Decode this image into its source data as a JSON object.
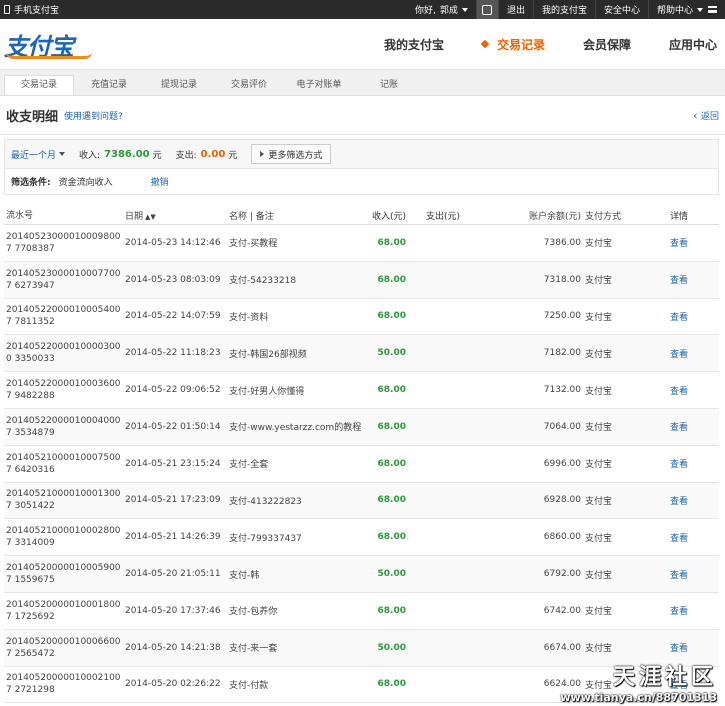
{
  "topbar": {
    "mobile_link": "手机支付宝",
    "greeting": "你好,",
    "username": "郭成",
    "logout": "退出",
    "my_alipay": "我的支付宝",
    "security": "安全中心",
    "help": "帮助中心"
  },
  "header": {
    "logo_text": "支付宝",
    "nav": [
      {
        "label": "我的支付宝",
        "active": false
      },
      {
        "label": "交易记录",
        "active": true
      },
      {
        "label": "会员保障",
        "active": false
      },
      {
        "label": "应用中心",
        "active": false
      }
    ]
  },
  "subnav": [
    "交易记录",
    "充值记录",
    "提现记录",
    "交易评价",
    "电子对账单",
    "记账"
  ],
  "page": {
    "title": "收支明细",
    "help_link": "使用遇到问题?",
    "back_link": "返回"
  },
  "filter": {
    "period": "最近一个月",
    "income_label": "收入:",
    "income_value": "7386.00",
    "expense_label": "支出:",
    "expense_value": "0.00",
    "unit": "元",
    "more_button": "更多筛选方式",
    "condition_label": "筛选条件:",
    "condition_value": "资金流向收入",
    "cancel": "撤销"
  },
  "table": {
    "headers": {
      "serial": "流水号",
      "date": "日期",
      "name": "名称 | 备注",
      "income": "收入(元)",
      "expense": "支出(元)",
      "balance": "账户余额(元)",
      "method": "支付方式",
      "detail": "详情"
    },
    "rows": [
      {
        "serial": "201405230000100098007 7708387",
        "date": "2014-05-23 14:12:46",
        "name": "支付-买教程",
        "income": "68.00",
        "balance": "7386.00",
        "method": "支付宝",
        "detail": "查看"
      },
      {
        "serial": "201405230000100077007 6273947",
        "date": "2014-05-23 08:03:09",
        "name": "支付-54233218",
        "income": "68.00",
        "balance": "7318.00",
        "method": "支付宝",
        "detail": "查看"
      },
      {
        "serial": "201405220000100054007 7811352",
        "date": "2014-05-22 14:07:59",
        "name": "支付-资料",
        "income": "68.00",
        "balance": "7250.00",
        "method": "支付宝",
        "detail": "查看"
      },
      {
        "serial": "201405220000100003000 3350033",
        "date": "2014-05-22 11:18:23",
        "name": "支付-韩国26部视频",
        "income": "50.00",
        "balance": "7182.00",
        "method": "支付宝",
        "detail": "查看"
      },
      {
        "serial": "201405220000100036007 9482288",
        "date": "2014-05-22 09:06:52",
        "name": "支付-好男人你懂得",
        "income": "68.00",
        "balance": "7132.00",
        "method": "支付宝",
        "detail": "查看"
      },
      {
        "serial": "201405220000100040007 3534879",
        "date": "2014-05-22 01:50:14",
        "name": "支付-www.yestarzz.com的教程",
        "income": "68.00",
        "balance": "7064.00",
        "method": "支付宝",
        "detail": "查看"
      },
      {
        "serial": "201405210000100075007 6420316",
        "date": "2014-05-21 23:15:24",
        "name": "支付-全套",
        "income": "68.00",
        "balance": "6996.00",
        "method": "支付宝",
        "detail": "查看"
      },
      {
        "serial": "201405210000100013007 3051422",
        "date": "2014-05-21 17:23:09",
        "name": "支付-413222823",
        "income": "68.00",
        "balance": "6928.00",
        "method": "支付宝",
        "detail": "查看"
      },
      {
        "serial": "201405210000100028007 3314009",
        "date": "2014-05-21 14:26:39",
        "name": "支付-799337437",
        "income": "68.00",
        "balance": "6860.00",
        "method": "支付宝",
        "detail": "查看"
      },
      {
        "serial": "201405200000100059007 1559675",
        "date": "2014-05-20 21:05:11",
        "name": "支付-韩",
        "income": "50.00",
        "balance": "6792.00",
        "method": "支付宝",
        "detail": "查看"
      },
      {
        "serial": "201405200000100018007 1725692",
        "date": "2014-05-20 17:37:46",
        "name": "支付-包养你",
        "income": "68.00",
        "balance": "6742.00",
        "method": "支付宝",
        "detail": "查看"
      },
      {
        "serial": "201405200000100066007 2565472",
        "date": "2014-05-20 14:21:38",
        "name": "支付-来一套",
        "income": "50.00",
        "balance": "6674.00",
        "method": "支付宝",
        "detail": "查看"
      },
      {
        "serial": "201405200000100021007 2721298",
        "date": "2014-05-20 02:26:22",
        "name": "支付-付款",
        "income": "68.00",
        "balance": "6624.00",
        "method": "支付宝",
        "detail": "查看"
      }
    ]
  },
  "watermark": {
    "line1": "天涯社区",
    "line2": "www.tianya.cn/88701313"
  },
  "colors": {
    "brand_blue": "#1e65b4",
    "accent_orange": "#f06000",
    "income_green": "#2b9a3a",
    "topbar_bg": "#2b2b2b"
  }
}
